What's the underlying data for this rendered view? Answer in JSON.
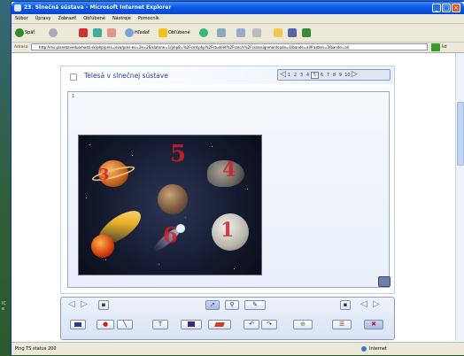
{
  "window": {
    "title": "23. Slnečná sústava - Microsoft Internet Explorer",
    "controls": {
      "minimize": "_",
      "maximize": "□",
      "close": "×"
    }
  },
  "menu": [
    "Súbor",
    "Úpravy",
    "Zobraziť",
    "Obľúbené",
    "Nástroje",
    "Pomocník"
  ],
  "toolbar": {
    "back_label": "Späť",
    "search_label": "Hľadať",
    "favorites_label": "Obľúbené"
  },
  "address": {
    "label": "Adresa",
    "url": "http://ms.planetaveduomosti.sk/php/pres=eva/pres-ev=2k=26/slatone=1/php8=%2Fcmf.php%2Fstudent%2Fsa/c/s%2Fcs/assignmentcode=1/bande=allfrastlon=3/bande=all",
    "go_label": "Ísť"
  },
  "status": {
    "text": "Ping TS status 200",
    "zone": "Internet"
  },
  "lesson": {
    "title": "Telesá v slnečnej sústave",
    "pages": [
      "1",
      "2",
      "3",
      "4",
      "5",
      "6",
      "7",
      "8",
      "9",
      "10"
    ],
    "current_page": "5",
    "slide_marker": "1",
    "canvas_numbers": [
      "5",
      "4",
      "3",
      "6",
      "1"
    ]
  },
  "colors": {
    "xp_title_blue": "#0a58e6",
    "accent_red": "#d42026",
    "panel_border": "#8a9bb8"
  },
  "tools": {
    "select": "pointer-icon",
    "zoom": "magnifier-icon",
    "text": "T"
  }
}
